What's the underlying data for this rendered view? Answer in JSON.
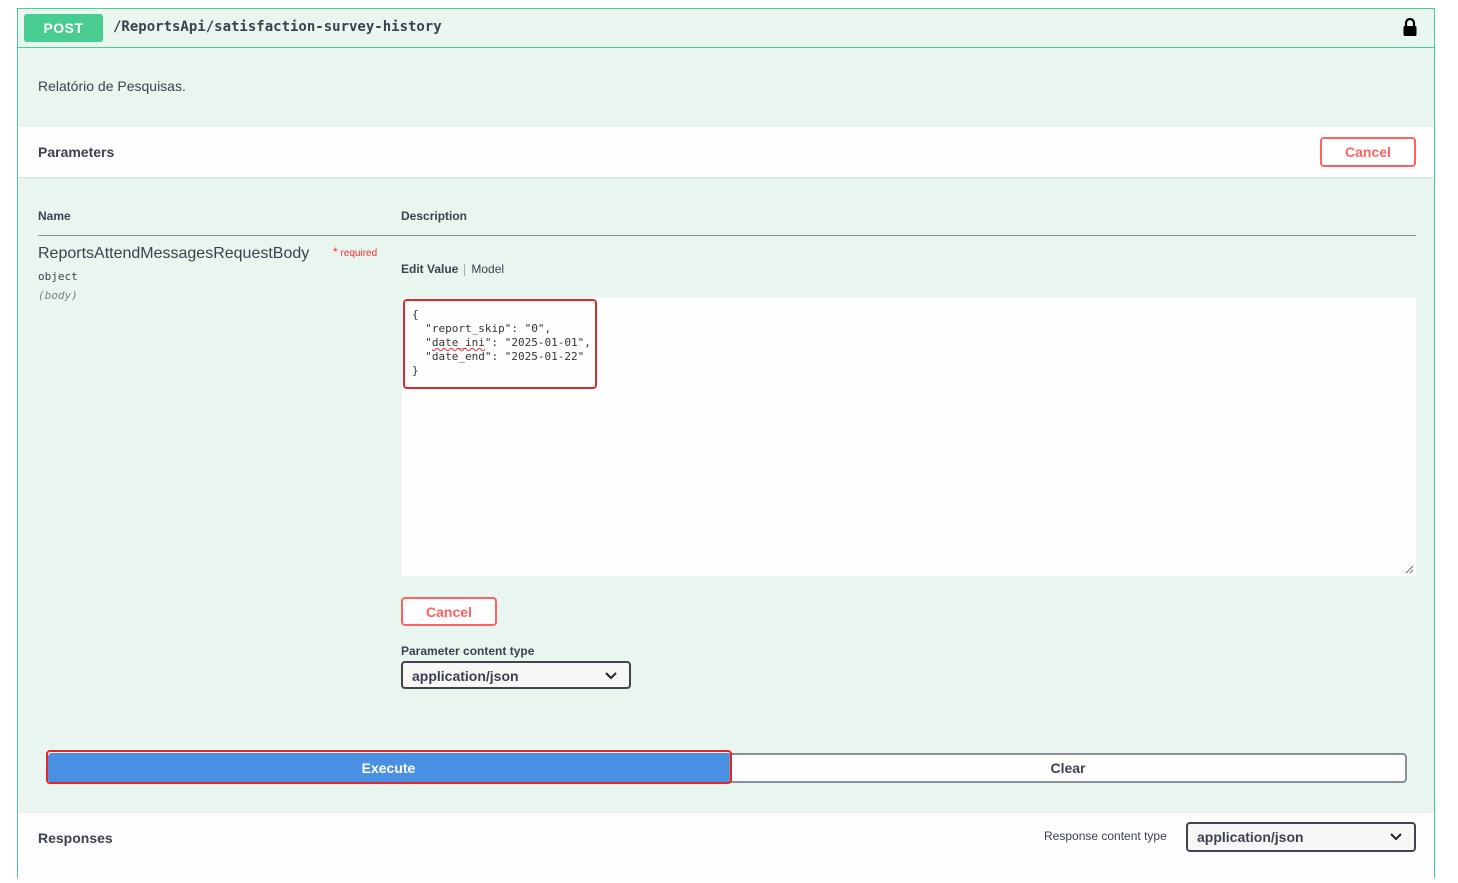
{
  "operation": {
    "method": "POST",
    "path": "/ReportsApi/satisfaction-survey-history",
    "description": "Relatório de Pesquisas.",
    "lock_icon": "lock-icon"
  },
  "parameters": {
    "title": "Parameters",
    "cancel_label": "Cancel",
    "col_name": "Name",
    "col_description": "Description",
    "param": {
      "name": "ReportsAttendMessagesRequestBody",
      "required_mark": "*",
      "required_label": "required",
      "type": "object",
      "in": "(body)"
    },
    "tabs": {
      "edit_value": "Edit Value",
      "model": "Model"
    },
    "body": {
      "open": "{",
      "k1": "\"report_skip\"",
      "v1": ": \"0\",",
      "k2q": "\"",
      "k2": "date_ini",
      "k2e": "\"",
      "v2": ": \"2025-01-01\",",
      "k3q": "\"",
      "k3": "date_end",
      "k3e": "\"",
      "v3": ": \"2025-01-22\"",
      "close": "}"
    },
    "editor_cancel_label": "Cancel",
    "content_type_label": "Parameter content type",
    "content_type_value": "application/json"
  },
  "actions": {
    "execute_label": "Execute",
    "clear_label": "Clear"
  },
  "responses": {
    "title": "Responses",
    "content_type_label": "Response content type",
    "content_type_value": "application/json"
  },
  "colors": {
    "post": "#49cc90",
    "execute": "#4990e2",
    "cancel": "#ff6060",
    "highlight": "#e3262c"
  }
}
